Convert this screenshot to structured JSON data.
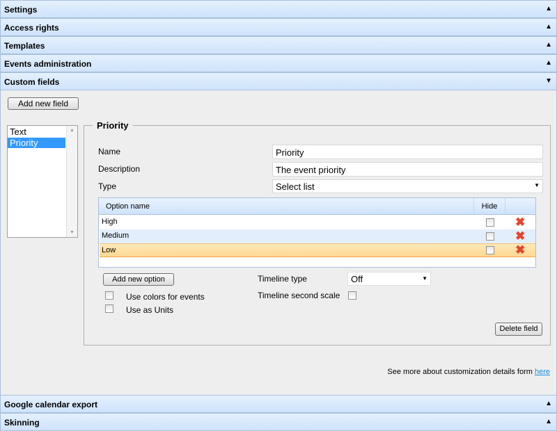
{
  "sections_top": [
    {
      "label": "Settings",
      "chevron": "chevron-up-icon"
    },
    {
      "label": "Access rights",
      "chevron": "chevron-up-icon"
    },
    {
      "label": "Templates",
      "chevron": "chevron-up-icon"
    },
    {
      "label": "Events administration",
      "chevron": "chevron-up-icon"
    },
    {
      "label": "Custom fields",
      "chevron": "chevron-down-icon"
    }
  ],
  "sections_bottom": [
    {
      "label": "Google calendar export",
      "chevron": "chevron-up-icon"
    },
    {
      "label": "Skinning",
      "chevron": "chevron-up-icon"
    }
  ],
  "custom_fields": {
    "add_field_label": "Add new field",
    "field_list": [
      "Text",
      "Priority"
    ],
    "selected_field": "Priority",
    "legend": "Priority",
    "name_label": "Name",
    "name_value": "Priority",
    "description_label": "Description",
    "description_value": "The event priority",
    "type_label": "Type",
    "type_value": "Select list",
    "table": {
      "col_option": "Option name",
      "col_hide": "Hide",
      "rows": [
        {
          "name": "High",
          "hide": false
        },
        {
          "name": "Medium",
          "hide": false
        },
        {
          "name": "Low",
          "hide": false,
          "selected": true
        }
      ]
    },
    "add_option_label": "Add new option",
    "use_colors_label": "Use colors for events",
    "use_units_label": "Use as Units",
    "timeline_type_label": "Timeline type",
    "timeline_type_value": "Off",
    "timeline_second_label": "Timeline second scale",
    "delete_field_label": "Delete field",
    "footer_text": "See more about customization details form ",
    "footer_link": "here"
  }
}
